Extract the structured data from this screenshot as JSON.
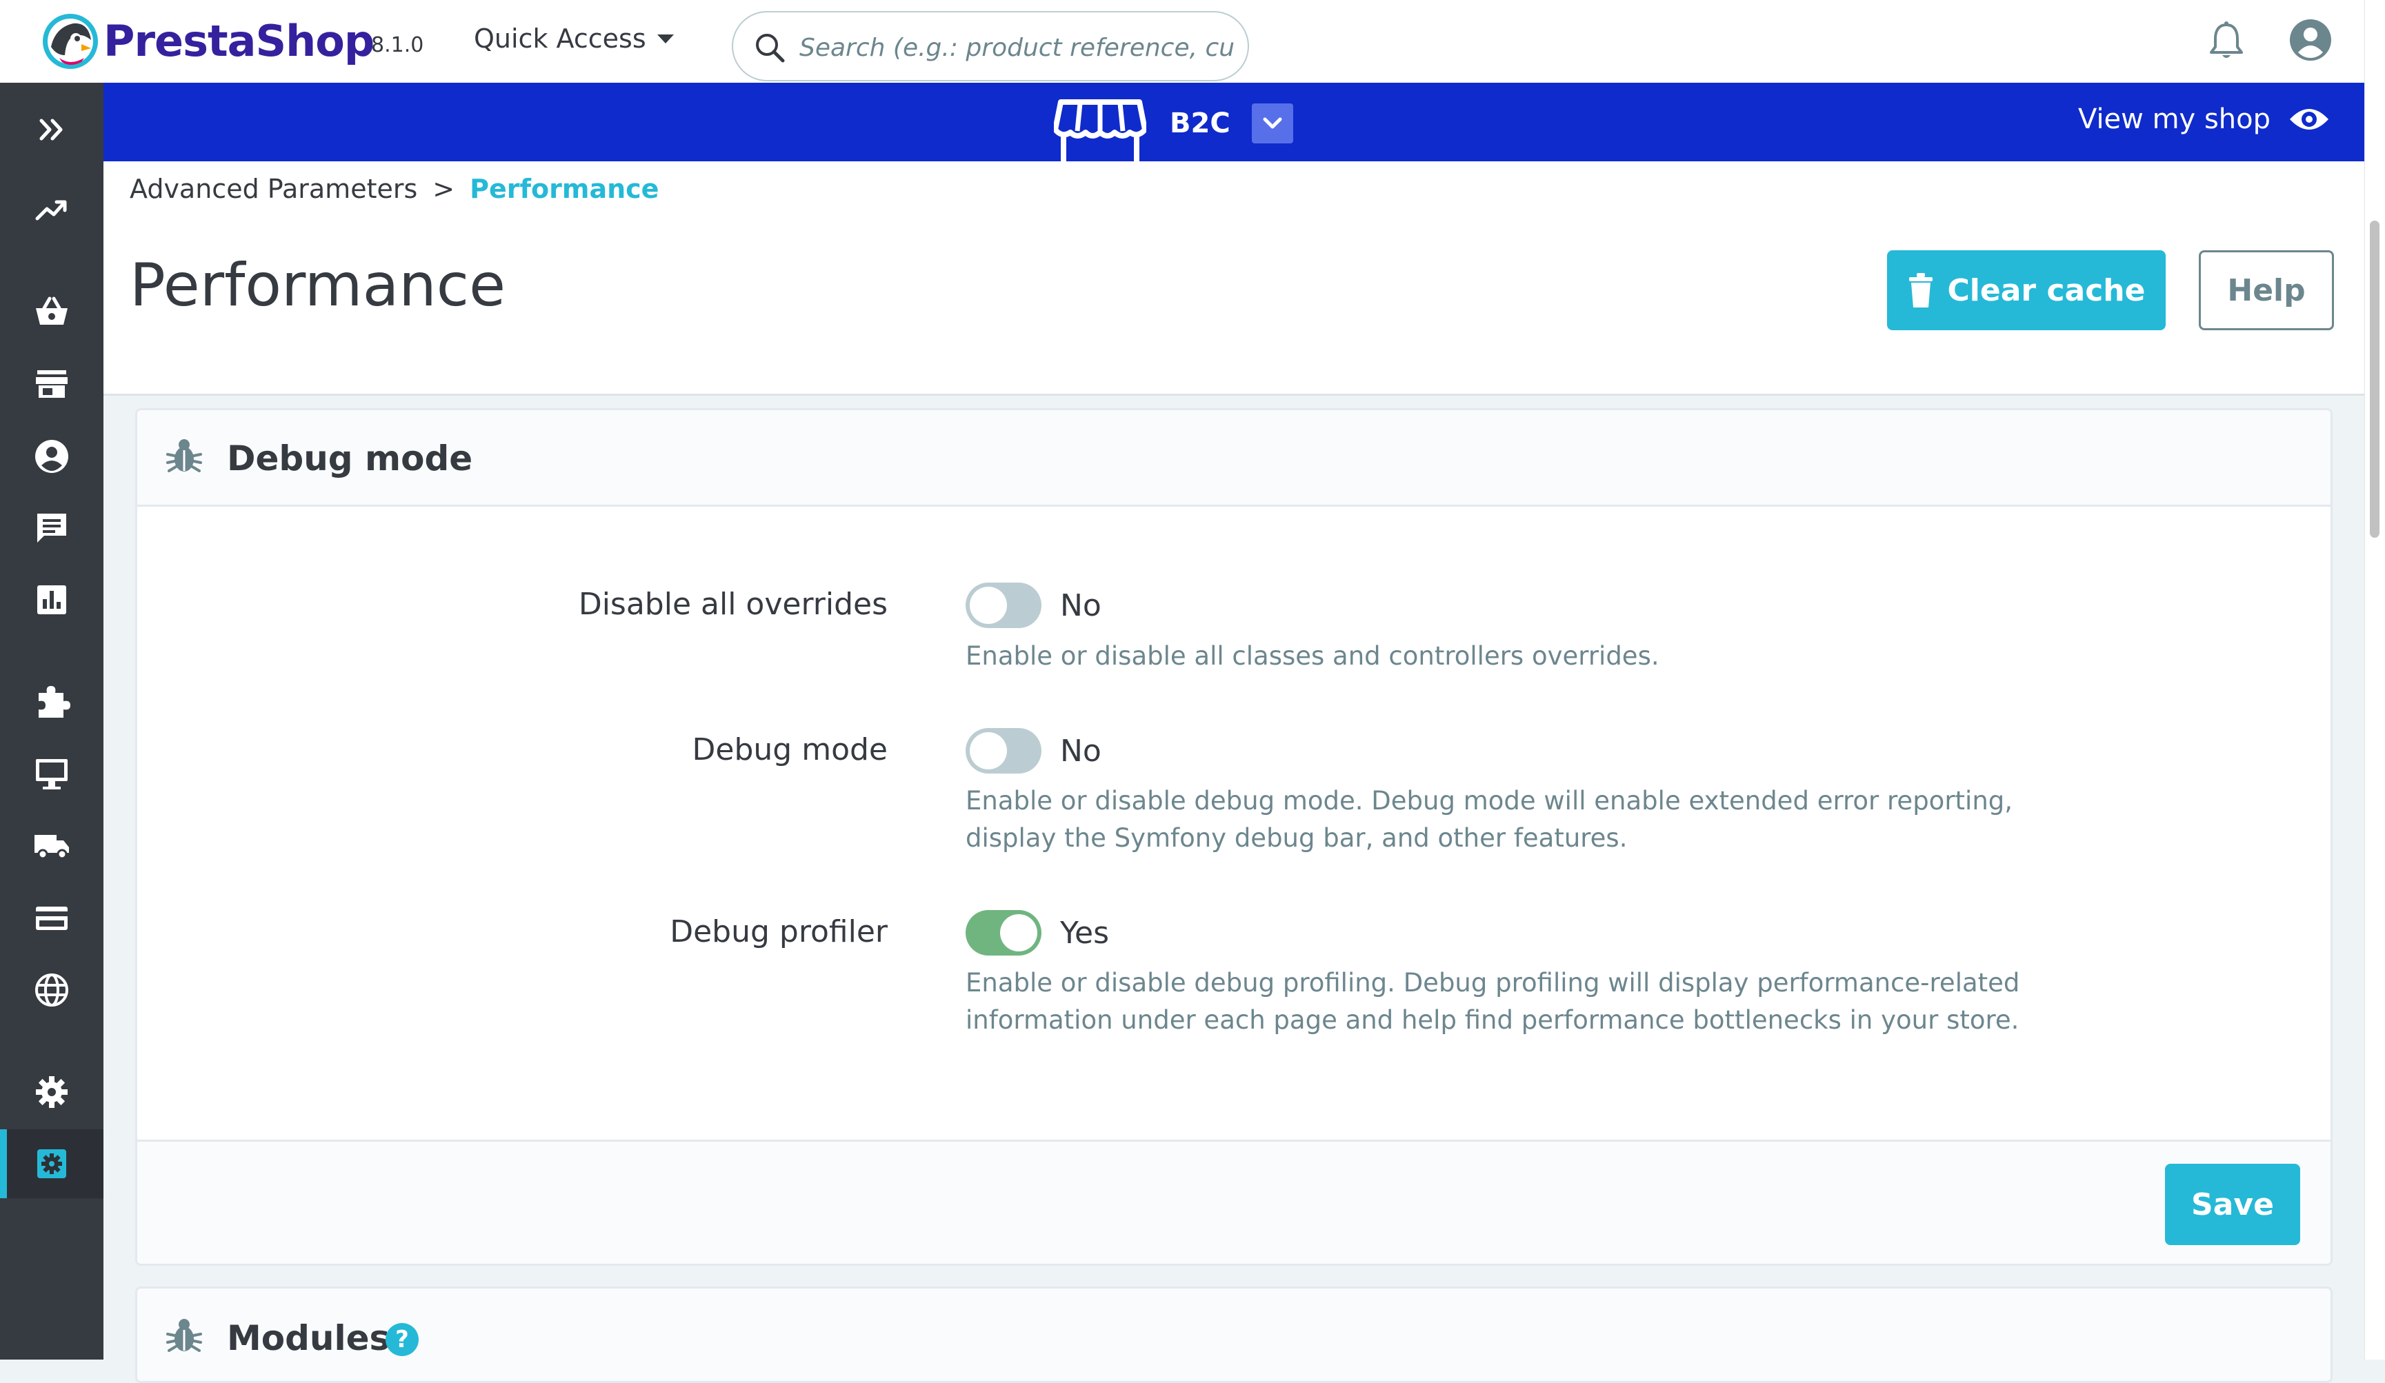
{
  "header": {
    "brand": "PrestaShop",
    "version": "8.1.0",
    "quick_access": "Quick Access",
    "search_placeholder": "Search (e.g.: product reference, custon",
    "icons": [
      "prestashop-logo-icon",
      "caret-down-icon",
      "search-icon",
      "bell-icon",
      "account-icon"
    ]
  },
  "sidebar": {
    "items": [
      {
        "name": "expand-menu",
        "icon": "double-chevron-right-icon",
        "active": false
      },
      {
        "name": "dashboard",
        "icon": "trending-up-icon",
        "active": false
      },
      {
        "name": "orders",
        "icon": "basket-icon",
        "active": false
      },
      {
        "name": "catalog",
        "icon": "store-icon",
        "active": false
      },
      {
        "name": "customers",
        "icon": "user-circle-icon",
        "active": false
      },
      {
        "name": "customer-service",
        "icon": "chat-icon",
        "active": false
      },
      {
        "name": "stats",
        "icon": "bar-chart-icon",
        "active": false
      },
      {
        "name": "modules",
        "icon": "puzzle-icon",
        "active": false
      },
      {
        "name": "design",
        "icon": "desktop-icon",
        "active": false
      },
      {
        "name": "shipping",
        "icon": "truck-icon",
        "active": false
      },
      {
        "name": "payment",
        "icon": "credit-card-icon",
        "active": false
      },
      {
        "name": "international",
        "icon": "globe-icon",
        "active": false
      },
      {
        "name": "shop-parameters",
        "icon": "gear-icon",
        "active": false
      },
      {
        "name": "advanced-parameters",
        "icon": "advanced-gear-icon",
        "active": true
      }
    ]
  },
  "shopbar": {
    "shop_name": "B2C",
    "view_shop": "View my shop"
  },
  "breadcrumb": {
    "parent": "Advanced Parameters",
    "separator": ">",
    "current": "Performance"
  },
  "page": {
    "title": "Performance",
    "clear_cache": "Clear cache",
    "help": "Help"
  },
  "debug_card": {
    "title": "Debug mode",
    "fields": [
      {
        "label": "Disable all overrides",
        "state": "No",
        "enabled": false,
        "hint": "Enable or disable all classes and controllers overrides."
      },
      {
        "label": "Debug mode",
        "state": "No",
        "enabled": false,
        "hint": "Enable or disable debug mode. Debug mode will enable extended error reporting, display the Symfony debug bar, and other features."
      },
      {
        "label": "Debug profiler",
        "state": "Yes",
        "enabled": true,
        "hint": "Enable or disable debug profiling. Debug profiling will display performance-related information under each page and help find performance bottlenecks in your store."
      }
    ],
    "save": "Save"
  },
  "modules_card": {
    "title": "Modules",
    "help_mark": "?"
  },
  "colors": {
    "accent": "#25b9d7",
    "brand_purple": "#34219e",
    "shop_bar": "#0f2bcc",
    "sidebar": "#363a41",
    "switch_on": "#70b580",
    "switch_off": "#bbcdd2"
  }
}
